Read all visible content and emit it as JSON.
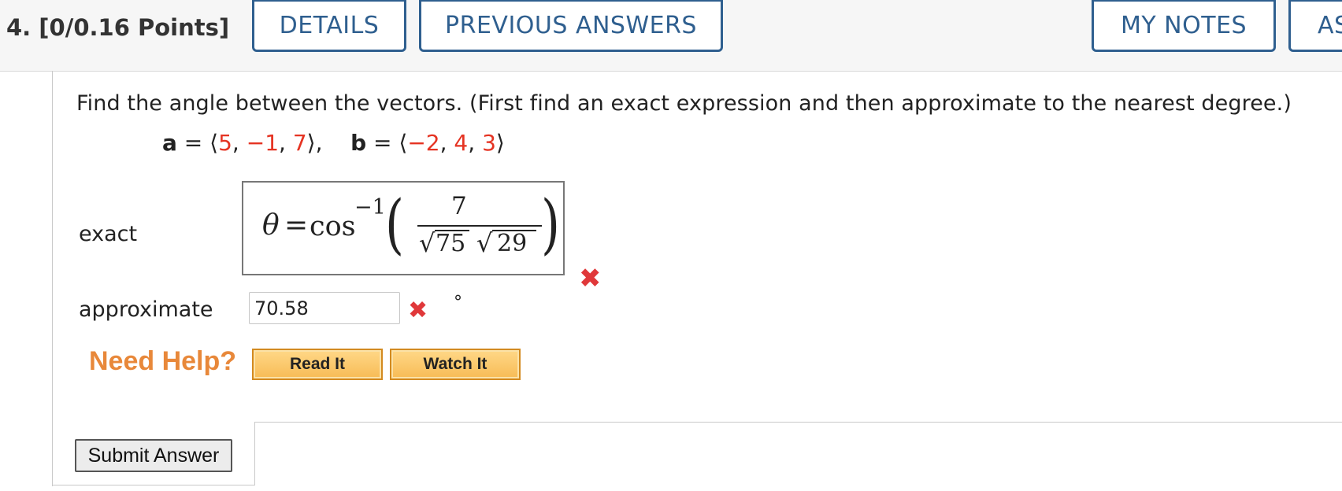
{
  "header": {
    "question_label": "4.  [0/0.16 Points]",
    "details_label": "DETAILS",
    "previous_answers_label": "PREVIOUS ANSWERS",
    "my_notes_label": "MY NOTES",
    "ask_label": "AS"
  },
  "question": {
    "prompt": "Find the angle between the vectors. (First find an exact expression and then approximate to the nearest degree.)",
    "vector_a_name": "a",
    "vector_a_values": [
      "5",
      "−1",
      "7"
    ],
    "vector_b_name": "b",
    "vector_b_values": [
      "−2",
      "4",
      "3"
    ]
  },
  "exact": {
    "label": "exact",
    "theta": "θ",
    "equals": "=",
    "func": "cos",
    "exponent": "−1",
    "numerator": "7",
    "radicand1": "75",
    "radicand2": "29",
    "status": "incorrect"
  },
  "approximate": {
    "label": "approximate",
    "value": "70.58",
    "unit": "°",
    "status": "incorrect"
  },
  "help": {
    "label": "Need Help?",
    "read_it": "Read It",
    "watch_it": "Watch It"
  },
  "submit": {
    "label": "Submit Answer"
  },
  "colors": {
    "accent": "#2f5f8f",
    "error": "#e0383a",
    "value_red": "#e53322",
    "help_orange": "#e8883a"
  },
  "icons": {
    "incorrect": "x-mark-icon"
  }
}
